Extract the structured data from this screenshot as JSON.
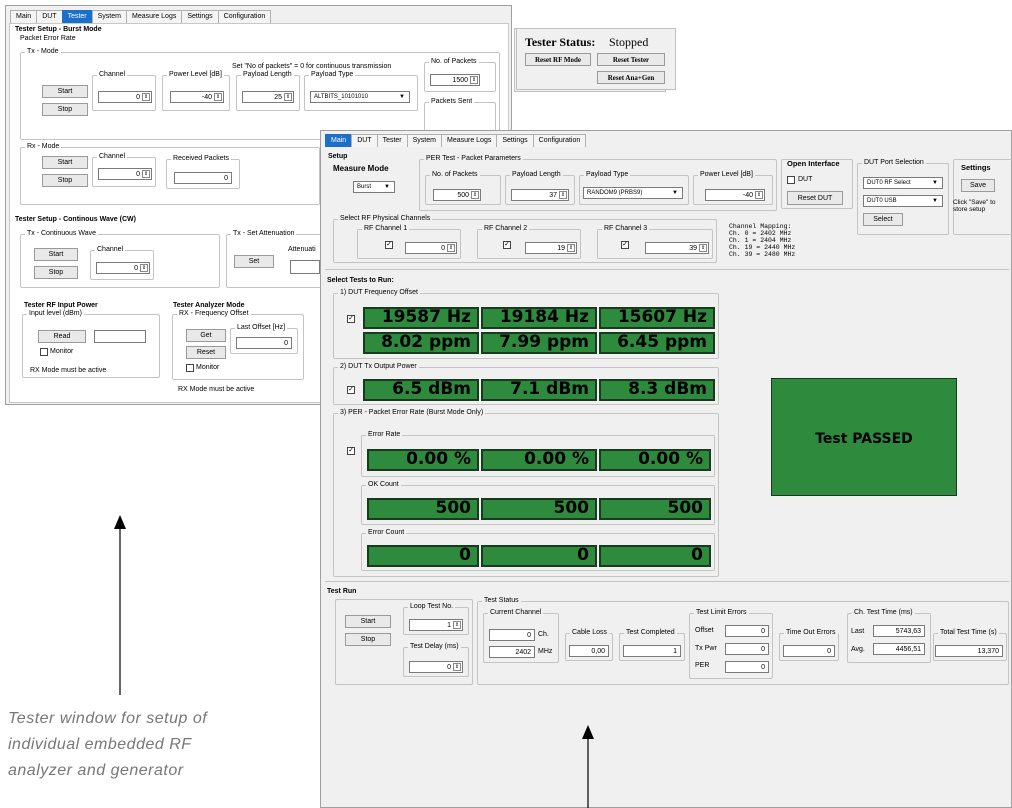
{
  "back": {
    "tabs": [
      "Main",
      "DUT",
      "Tester",
      "System",
      "Measure Logs",
      "Settings",
      "Configuration"
    ],
    "burst_title": "Tester Setup - Burst Mode",
    "per_label": "Packet Error Rate",
    "tx_mode": "Tx - Mode",
    "hint": "Set \"No of packets\" = 0 for continuous transmission",
    "start": "Start",
    "stop": "Stop",
    "channel": "Channel",
    "channel_val": "0",
    "power_level": "Power Level [dB]",
    "power_val": "-40",
    "payload_length": "Payload Length",
    "payload_length_val": "25",
    "payload_type": "Payload Type",
    "payload_type_val": "ALTBITS_10101010",
    "no_packets": "No. of Packets",
    "no_packets_val": "1500",
    "packets_sent": "Packets Sent",
    "rx_mode": "Rx - Mode",
    "rx_channel_val": "0",
    "received_packets": "Received Packets",
    "received_val": "0",
    "status_label": "Tester Status:",
    "status_val": "Stopped",
    "reset_rf": "Reset RF Mode",
    "reset_tester": "Reset Tester",
    "reset_ana": "Reset Ana+Gen",
    "cw_title": "Tester Setup - Continous Wave (CW)",
    "tx_cw": "Tx - Continuous Wave",
    "cw_channel_val": "0",
    "tx_att": "Tx - Set Attenuation",
    "set": "Set",
    "attenuation": "Attenuati",
    "rf_input_title": "Tester RF Input Power",
    "input_level": "Input level (dBm)",
    "read": "Read",
    "monitor": "Monitor",
    "rx_note": "RX Mode must be active",
    "analyzer_title": "Tester Analyzer Mode",
    "rx_freq": "RX - Frequency Offset",
    "get": "Get",
    "reset": "Reset",
    "last_offset": "Last Offset [Hz]",
    "last_offset_val": "0",
    "monitor2": "Monitor",
    "rx_note2": "RX Mode must be active"
  },
  "front": {
    "tabs": [
      "Main",
      "DUT",
      "Tester",
      "System",
      "Measure Logs",
      "Settings",
      "Configuration"
    ],
    "setup": "Setup",
    "measure_mode": "Measure Mode",
    "measure_val": "Burst",
    "per_params": "PER Test - Packet Parameters",
    "no_packets": "No. of Packets",
    "no_packets_val": "500",
    "payload_length": "Payload Length",
    "payload_length_val": "37",
    "payload_type": "Payload Type",
    "payload_type_val": "RANDOM9 (PRBS9)",
    "power_level": "Power Level [dB]",
    "power_val": "-40",
    "open_interface": "Open Interface",
    "dut": "DUT",
    "reset_dut": "Reset DUT",
    "dut_port": "DUT Port Selection",
    "dut_rf_select": "DUT0 RF Select",
    "dut_usb": "DUT0 USB",
    "select": "Select",
    "settings": "Settings",
    "save": "Save",
    "save_hint": "Click \"Save\" to store setup",
    "rf_phys": "Select RF Physical Channels",
    "rf1": "RF Channel 1",
    "rf1_val": "0",
    "rf2": "RF Channel 2",
    "rf2_val": "19",
    "rf3": "RF Channel 3",
    "rf3_val": "39",
    "mapping_title": "Channel Mapping:",
    "map": [
      "Ch.  0 = 2402 MHz",
      "Ch.  1 = 2404 MHz",
      "Ch. 19 = 2440 MHz",
      "Ch. 39 = 2480 MHz"
    ],
    "select_tests": "Select Tests to Run:",
    "t1": "1) DUT Frequency Offset",
    "hz": [
      "19587 Hz",
      "19184 Hz",
      "15607 Hz"
    ],
    "ppm": [
      "8.02 ppm",
      "7.99 ppm",
      "6.45 ppm"
    ],
    "t2": "2) DUT Tx Output Power",
    "dbm": [
      "6.5 dBm",
      "7.1 dBm",
      "8.3 dBm"
    ],
    "t3": "3) PER - Packet Error Rate (Burst Mode Only)",
    "error_rate": "Error Rate",
    "er": [
      "0.00 %",
      "0.00 %",
      "0.00 %"
    ],
    "ok_count": "OK Count",
    "ok": [
      "500",
      "500",
      "500"
    ],
    "error_count": "Error Count",
    "ec": [
      "0",
      "0",
      "0"
    ],
    "passed": "Test PASSED",
    "test_run": "Test Run",
    "start": "Start",
    "stop": "Stop",
    "loop_test": "Loop Test No.",
    "loop_val": "1",
    "test_delay": "Test Delay (ms)",
    "delay_val": "0",
    "test_status": "Test Status",
    "current_channel": "Current Channel",
    "cur_ch_val": "0",
    "ch": "Ch.",
    "cur_mhz_val": "2402",
    "mhz": "MHz",
    "cable_loss": "Cable Loss",
    "cable_val": "0,00",
    "test_completed": "Test Completed",
    "completed_val": "1",
    "limit_errors": "Test Limit Errors",
    "offset": "Offset",
    "offset_val": "0",
    "txpwr": "Tx Pwr",
    "txpwr_val": "0",
    "per": "PER",
    "per_val": "0",
    "timeout": "Time Out Errors",
    "timeout_val": "0",
    "ch_time": "Ch. Test Time (ms)",
    "last": "Last",
    "last_val": "5743,63",
    "avg": "Avg.",
    "avg_val": "4456,51",
    "total_time": "Total Test Time (s)",
    "total_val": "13,370"
  },
  "captions": {
    "left": [
      "Tester window for setup of",
      "individual embedded RF",
      "analyzer and generator"
    ]
  },
  "colors": {
    "green": "#2e8b3e",
    "tab_active": "#1a6fc9"
  }
}
